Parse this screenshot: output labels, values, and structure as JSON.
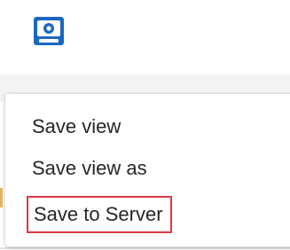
{
  "toolbar": {
    "save_icon": "save-icon",
    "accent_color": "#1b68c2"
  },
  "menu": {
    "items": [
      {
        "label": "Save view"
      },
      {
        "label": "Save view as"
      },
      {
        "label": "Save to Server",
        "highlighted": true,
        "highlight_color": "#d93a43"
      }
    ]
  }
}
